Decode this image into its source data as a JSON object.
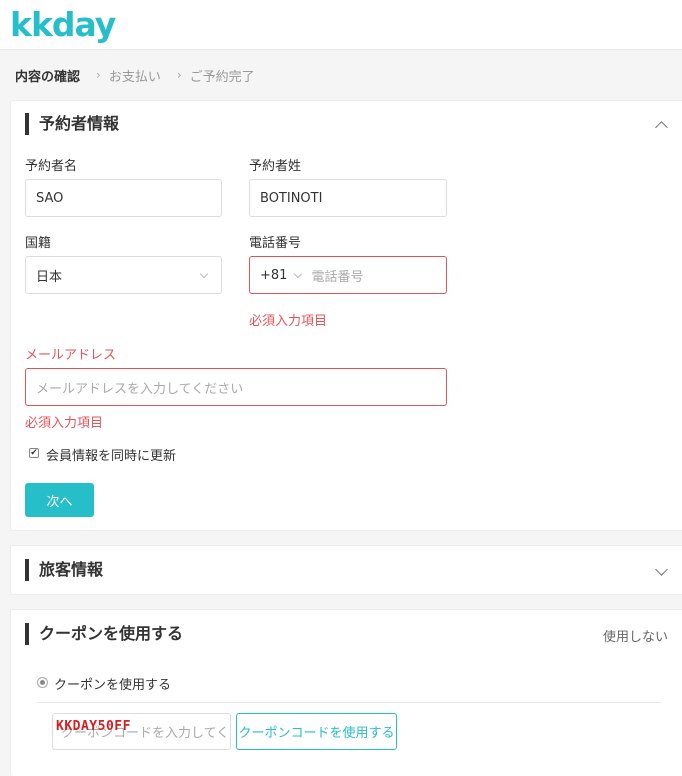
{
  "header": {
    "logo_text": "kkday"
  },
  "breadcrumb": {
    "step1": "内容の確認",
    "step2": "お支払い",
    "step3": "ご予約完了",
    "separator": "›"
  },
  "booker": {
    "title": "予約者情報",
    "first_name_label": "予約者名",
    "first_name_value": "SAO",
    "last_name_label": "予約者姓",
    "last_name_value": "BOTINOTI",
    "nationality_label": "国籍",
    "nationality_value": "日本",
    "phone_label": "電話番号",
    "phone_code": "+81",
    "phone_placeholder": "電話番号",
    "phone_error": "必須入力項目",
    "email_label": "メールアドレス",
    "email_placeholder": "メールアドレスを入力してください",
    "email_error": "必須入力項目",
    "update_member_label": "会員情報を同時に更新",
    "update_member_checked": true,
    "next_button": "次へ"
  },
  "traveler": {
    "title": "旅客情報"
  },
  "coupon": {
    "title": "クーポンを使用する",
    "not_use": "使用しない",
    "radio_label": "クーポンを使用する",
    "input_placeholder": "クーポンコードを入力してください",
    "stamp_text": "KKDAY50FF",
    "apply_button": "クーポンコードを使用する"
  },
  "colors": {
    "accent": "#26bec9",
    "error": "#e0555a",
    "stamp": "#d32020"
  }
}
